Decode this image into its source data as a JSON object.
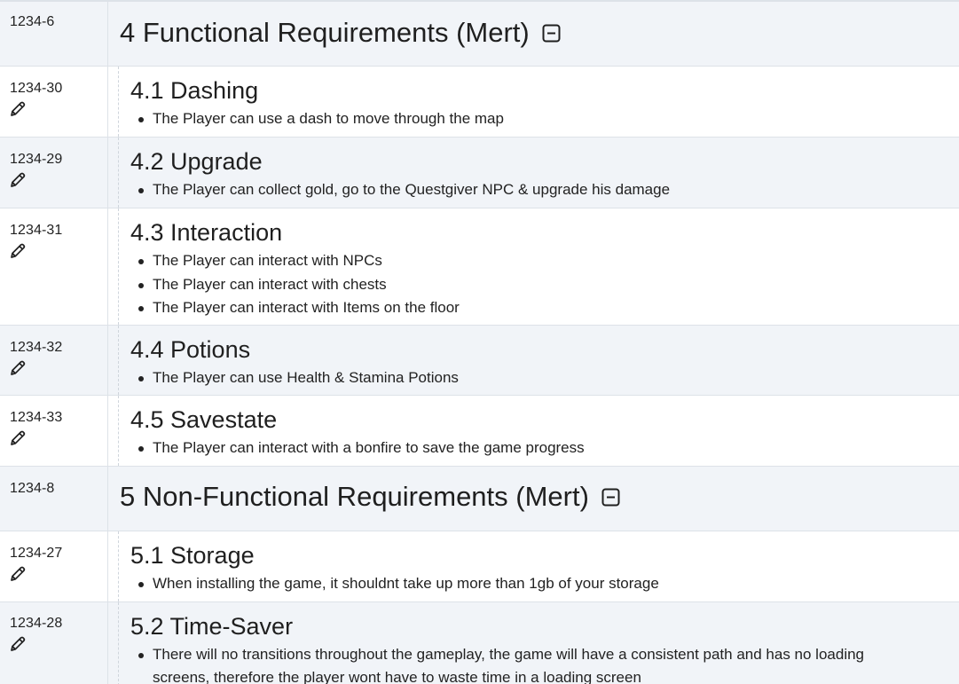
{
  "sections": [
    {
      "id": "1234-6",
      "title": "4 Functional Requirements (Mert)",
      "collapse_icon": "minus-square-icon"
    },
    {
      "id": "1234-30",
      "title": "4.1 Dashing",
      "edit_icon": "pencil-icon",
      "bullets": [
        "The Player can use a dash to move through the map"
      ]
    },
    {
      "id": "1234-29",
      "title": "4.2 Upgrade",
      "edit_icon": "pencil-icon",
      "bullets": [
        "The Player can collect gold, go to the Questgiver NPC & upgrade his damage"
      ]
    },
    {
      "id": "1234-31",
      "title": "4.3 Interaction",
      "edit_icon": "pencil-icon",
      "bullets": [
        "The Player can interact with NPCs",
        "The Player can interact with chests",
        "The Player can interact with Items on the floor"
      ]
    },
    {
      "id": "1234-32",
      "title": "4.4 Potions",
      "edit_icon": "pencil-icon",
      "bullets": [
        "The Player can use Health & Stamina Potions"
      ]
    },
    {
      "id": "1234-33",
      "title": "4.5 Savestate",
      "edit_icon": "pencil-icon",
      "bullets": [
        "The Player can interact with a bonfire to save the game progress"
      ]
    },
    {
      "id": "1234-8",
      "title": "5 Non-Functional Requirements (Mert)",
      "collapse_icon": "minus-square-icon"
    },
    {
      "id": "1234-27",
      "title": "5.1 Storage",
      "edit_icon": "pencil-icon",
      "bullets": [
        "When installing the game, it shouldnt take up more than 1gb of your storage"
      ]
    },
    {
      "id": "1234-28",
      "title": "5.2 Time-Saver",
      "edit_icon": "pencil-icon",
      "bullets": [
        "There will no transitions throughout the gameplay, the game will have a consistent path and has no loading screens, therefore the player wont have to waste time in a loading screen"
      ]
    }
  ],
  "colors": {
    "row_shaded": "#f1f4f8",
    "row_plain": "#ffffff",
    "border": "#dde2e8",
    "text": "#1f1f1f"
  }
}
